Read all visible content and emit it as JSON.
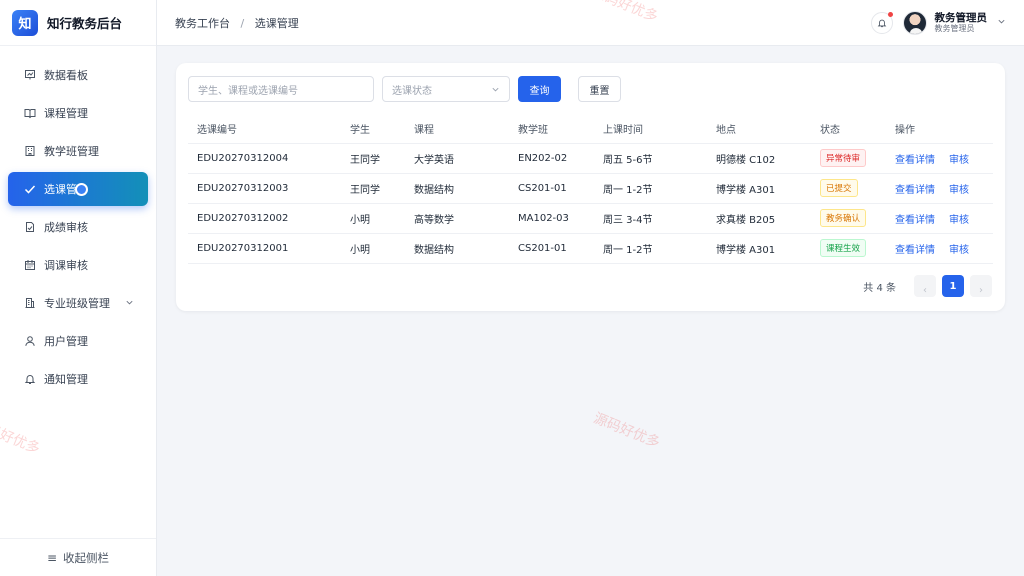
{
  "brand": {
    "logo": "知",
    "title": "知行教务后台"
  },
  "sidebar": {
    "items": [
      {
        "label": "数据看板",
        "icon": "presentation-chart-icon"
      },
      {
        "label": "课程管理",
        "icon": "book-open-icon"
      },
      {
        "label": "教学班管理",
        "icon": "building-icon"
      },
      {
        "label": "选课管",
        "icon": "check-icon",
        "active": true
      },
      {
        "label": "成绩审核",
        "icon": "document-check-icon"
      },
      {
        "label": "调课审核",
        "icon": "calendar-icon"
      },
      {
        "label": "专业班级管理",
        "icon": "office-building-icon",
        "expandable": true
      },
      {
        "label": "用户管理",
        "icon": "user-icon"
      },
      {
        "label": "通知管理",
        "icon": "bell-icon"
      }
    ],
    "collapse_label": "收起侧栏"
  },
  "header": {
    "breadcrumb": [
      "教务工作台",
      "选课管理"
    ],
    "breadcrumb_sep": "/",
    "user": {
      "name": "教务管理员",
      "role": "教务管理员"
    }
  },
  "filters": {
    "search_placeholder": "学生、课程或选课编号",
    "status_placeholder": "选课状态",
    "query_label": "查询",
    "reset_label": "重置"
  },
  "table": {
    "columns": [
      "选课编号",
      "学生",
      "课程",
      "教学班",
      "上课时间",
      "地点",
      "状态",
      "操作"
    ],
    "rows": [
      {
        "id": "EDU20270312004",
        "student": "王同学",
        "course": "大学英语",
        "class": "EN202-02",
        "time": "周五 5-6节",
        "place": "明德楼 C102",
        "status": "异常待审",
        "status_color": "#dc2626",
        "detail": "查看详情",
        "review": "审核"
      },
      {
        "id": "EDU20270312003",
        "student": "王同学",
        "course": "数据结构",
        "class": "CS201-01",
        "time": "周一 1-2节",
        "place": "博学楼 A301",
        "status": "已提交",
        "status_color": "#d97706",
        "detail": "查看详情",
        "review": "审核"
      },
      {
        "id": "EDU20270312002",
        "student": "小明",
        "course": "高等数学",
        "class": "MA102-03",
        "time": "周三 3-4节",
        "place": "求真楼 B205",
        "status": "教务确认",
        "status_color": "#d97706",
        "detail": "查看详情",
        "review": "审核"
      },
      {
        "id": "EDU20270312001",
        "student": "小明",
        "course": "数据结构",
        "class": "CS201-01",
        "time": "周一 1-2节",
        "place": "博学楼 A301",
        "status": "课程生效",
        "status_color": "#16a34a",
        "detail": "查看详情",
        "review": "审核"
      }
    ]
  },
  "pagination": {
    "total_text": "共 4 条",
    "current_page": "1",
    "prev": "‹",
    "next": "›"
  },
  "watermark": "源码好优多",
  "colors": {
    "primary": "#2563eb",
    "active_gradient_end": "#1390b8",
    "danger": "#dc2626",
    "warning": "#d97706",
    "success": "#16a34a"
  }
}
